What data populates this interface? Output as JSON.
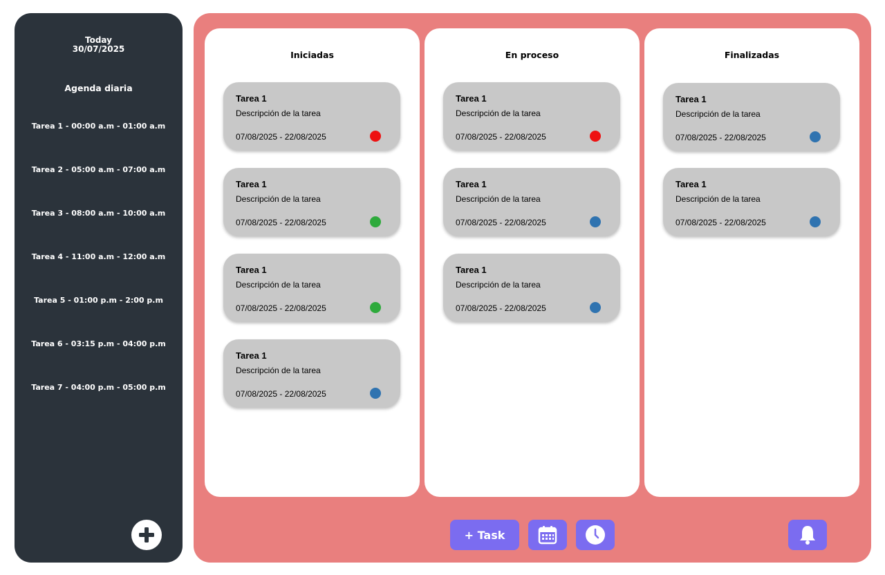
{
  "sidebar": {
    "today_label": "Today",
    "date": "30/07/2025",
    "agenda_title": "Agenda diaria",
    "items": [
      "Tarea 1 - 00:00 a.m - 01:00 a.m",
      "Tarea 2 - 05:00 a.m - 07:00 a.m",
      "Tarea 3 - 08:00 a.m - 10:00 a.m",
      "Tarea 4 - 11:00 a.m - 12:00 a.m",
      "Tarea 5 - 01:00 p.m - 2:00 p.m",
      "Tarea 6 - 03:15 p.m - 04:00 p.m",
      "Tarea 7 - 04:00 p.m - 05:00 p.m"
    ],
    "add_icon": "plus-icon"
  },
  "colors": {
    "sidebar_bg": "#2b333b",
    "main_bg": "#e97f7e",
    "card_bg": "#c8c8c8",
    "button_bg": "#7b6cf0",
    "status_red": "#ee1111",
    "status_green": "#2eaa3c",
    "status_blue": "#2f73b0"
  },
  "columns": [
    {
      "title": "Iniciadas",
      "cards": [
        {
          "title": "Tarea 1",
          "description": "Descripción de la tarea",
          "dates": "07/08/2025 - 22/08/2025",
          "status_color": "#ee1111"
        },
        {
          "title": "Tarea 1",
          "description": "Descripción de la tarea",
          "dates": "07/08/2025 - 22/08/2025",
          "status_color": "#2eaa3c"
        },
        {
          "title": "Tarea 1",
          "description": "Descripción de la tarea",
          "dates": "07/08/2025 - 22/08/2025",
          "status_color": "#2eaa3c"
        },
        {
          "title": "Tarea 1",
          "description": "Descripción de la tarea",
          "dates": "07/08/2025 - 22/08/2025",
          "status_color": "#2f73b0"
        }
      ]
    },
    {
      "title": "En proceso",
      "cards": [
        {
          "title": "Tarea 1",
          "description": "Descripción de la tarea",
          "dates": "07/08/2025 - 22/08/2025",
          "status_color": "#ee1111"
        },
        {
          "title": "Tarea 1",
          "description": "Descripción de la tarea",
          "dates": "07/08/2025 - 22/08/2025",
          "status_color": "#2f73b0"
        },
        {
          "title": "Tarea 1",
          "description": "Descripción de la tarea",
          "dates": "07/08/2025 - 22/08/2025",
          "status_color": "#2f73b0"
        }
      ]
    },
    {
      "title": "Finalizadas",
      "cards": [
        {
          "title": "Tarea 1",
          "description": "Descripción de la tarea",
          "dates": "07/08/2025 - 22/08/2025",
          "status_color": "#2f73b0"
        },
        {
          "title": "Tarea 1",
          "description": "Descripción de la tarea",
          "dates": "07/08/2025 - 22/08/2025",
          "status_color": "#2f73b0"
        }
      ]
    }
  ],
  "toolbar": {
    "task_button": "+ Task",
    "calendar_icon": "calendar-icon",
    "clock_icon": "clock-icon",
    "bell_icon": "bell-icon"
  }
}
